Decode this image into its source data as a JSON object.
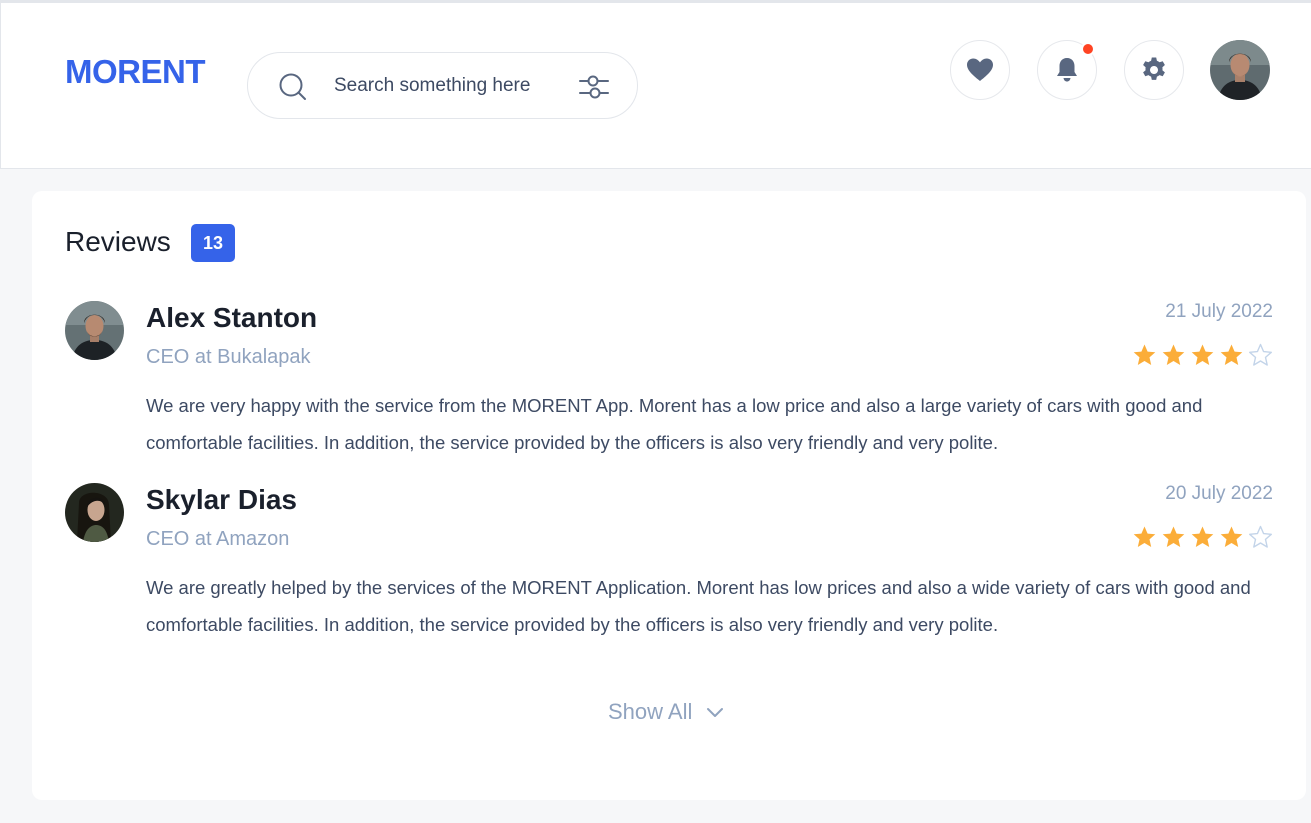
{
  "brand": {
    "logo_text": "MORENT",
    "color": "#3563e9"
  },
  "search": {
    "placeholder": "Search something here",
    "icon": "search-icon",
    "filter_icon": "filter-icon"
  },
  "header_actions": [
    {
      "name": "favorites",
      "icon": "heart-icon"
    },
    {
      "name": "notifications",
      "icon": "bell-icon",
      "has_unread_dot": true
    },
    {
      "name": "settings",
      "icon": "gear-icon"
    }
  ],
  "user_avatar": {
    "icon": "avatar"
  },
  "reviews": {
    "title": "Reviews",
    "count": "13",
    "items": [
      {
        "name": "Alex Stanton",
        "role": "CEO at Bukalapak",
        "date": "21 July 2022",
        "rating": 4,
        "max_rating": 5,
        "text": "We are very happy with the service from the MORENT App. Morent has a low price and also a large variety of cars with good and comfortable facilities. In addition, the service provided by the officers is also very friendly and very polite."
      },
      {
        "name": "Skylar Dias",
        "role": "CEO at Amazon",
        "date": "20 July 2022",
        "rating": 4,
        "max_rating": 5,
        "text": "We are greatly helped by the services of the MORENT Application. Morent has low prices and also a wide variety of cars with good and comfortable facilities. In addition, the service provided by the officers is also very friendly and very polite."
      }
    ],
    "show_all_label": "Show All"
  },
  "colors": {
    "accent": "#3563e9",
    "star_filled": "#fbad39",
    "star_empty": "#c3d4e9",
    "notification_dot": "#ff4423",
    "icon": "#596780"
  }
}
